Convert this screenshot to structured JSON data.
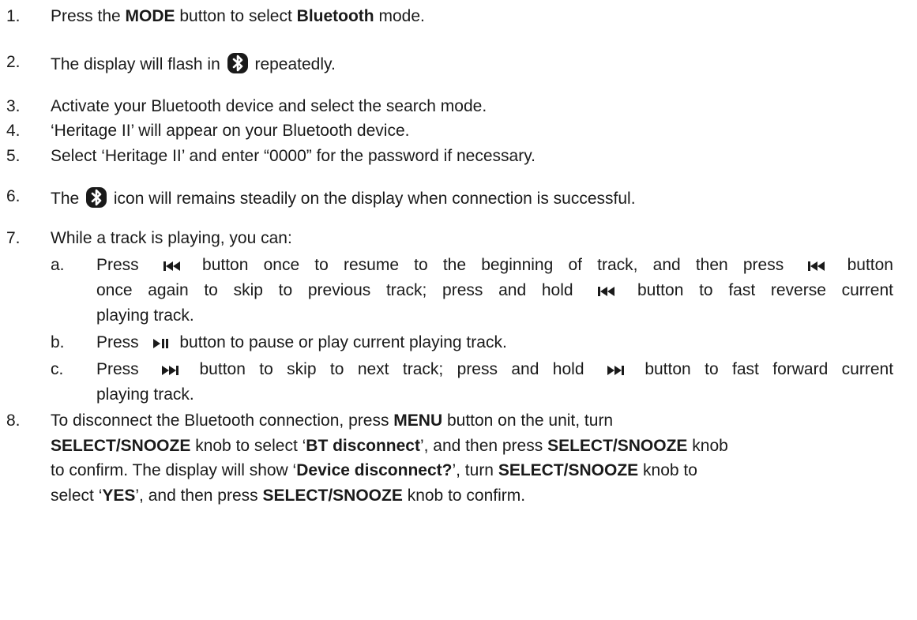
{
  "steps": {
    "s1": {
      "num": "1.",
      "a": "Press the ",
      "b1": "MODE",
      "c": " button to select ",
      "b2": "Bluetooth",
      "d": " mode."
    },
    "s2": {
      "num": "2.",
      "a": "The display will flash in",
      "b": "repeatedly."
    },
    "s3": {
      "num": "3.",
      "text": "Activate your Bluetooth device and select the search mode."
    },
    "s4": {
      "num": "4.",
      "text": "‘Heritage II’ will appear on your Bluetooth device."
    },
    "s5": {
      "num": "5.",
      "text": "Select ‘Heritage II’ and enter “0000” for the password if necessary."
    },
    "s6": {
      "num": "6.",
      "a": "The",
      "b": "icon will remains steadily on the display when connection is successful."
    },
    "s7": {
      "num": "7.",
      "text": "While a track is playing, you can:",
      "sub_a": {
        "letter": "a.",
        "p1": "Press",
        "p2": "button once to resume to the beginning of track, and then press",
        "p3": "button",
        "p4": "once again to skip to previous track; press and hold",
        "p5": "button to fast reverse current",
        "p6": "playing track."
      },
      "sub_b": {
        "letter": "b.",
        "p1": "Press",
        "p2": "button to pause or play current playing track."
      },
      "sub_c": {
        "letter": "c.",
        "p1": "Press",
        "p2": "button to skip to next track; press and hold",
        "p3": "button to fast forward current",
        "p4": "playing track."
      }
    },
    "s8": {
      "num": "8.",
      "l1a": "To disconnect the Bluetooth connection, press ",
      "l1b": "MENU",
      "l1c": " button on the unit, turn",
      "l2a": "SELECT/SNOOZE",
      "l2b": " knob to select ‘",
      "l2c": "BT disconnect",
      "l2d": "’, and then press ",
      "l2e": "SELECT/SNOOZE",
      "l2f": " knob",
      "l3a": "to confirm. The display will show ‘",
      "l3b": "Device disconnect?",
      "l3c": "’, turn ",
      "l3d": "SELECT/SNOOZE",
      "l3e": " knob to",
      "l4a": "select ‘",
      "l4b": "YES",
      "l4c": "’, and then press ",
      "l4d": "SELECT/SNOOZE",
      "l4e": " knob to confirm."
    }
  },
  "icons": {
    "bluetooth": "bluetooth-icon",
    "prev": "skip-previous-icon",
    "playpause": "play-pause-icon",
    "next": "skip-next-icon"
  }
}
